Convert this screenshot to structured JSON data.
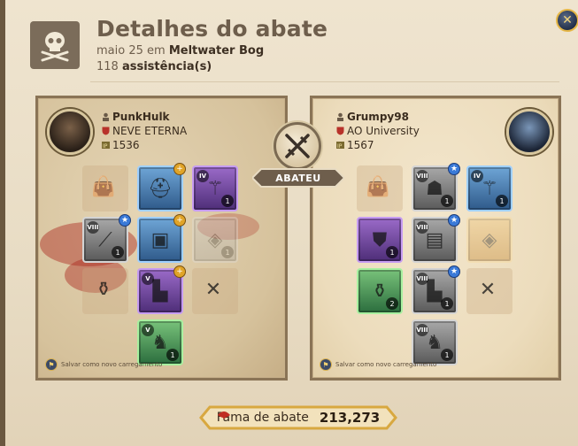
{
  "header": {
    "title": "Detalhes do abate",
    "date": "maio 25 em",
    "location": "Meltwater Bog",
    "assist_count": "118",
    "assist_label": "assistência(s)"
  },
  "killer": {
    "name": "PunkHulk",
    "guild": "NEVE ETERNA",
    "ip": "1536",
    "save_label": "Salvar como novo carregamento",
    "slots": [
      {
        "kind": "empty",
        "icon": "bag-icon"
      },
      {
        "kind": "item",
        "icon": "helmet-icon",
        "tier": "",
        "qty": "",
        "enchant": "+"
      },
      {
        "kind": "item",
        "icon": "staff-icon",
        "tier": "IV",
        "qty": "1",
        "enchant": ""
      },
      {
        "kind": "item",
        "icon": "spear-icon",
        "tier": "VIII",
        "qty": "1",
        "enchant": "★"
      },
      {
        "kind": "item",
        "icon": "armor-icon",
        "tier": "",
        "qty": "",
        "enchant": "+"
      },
      {
        "kind": "item",
        "icon": "offhand-icon",
        "tier": "",
        "qty": "1",
        "enchant": ""
      },
      {
        "kind": "empty",
        "icon": "potion-icon"
      },
      {
        "kind": "item",
        "icon": "boots-icon",
        "tier": "V",
        "qty": "",
        "enchant": "+"
      },
      {
        "kind": "empty",
        "icon": "food-icon"
      },
      {
        "kind": "item",
        "icon": "mount-icon",
        "tier": "V",
        "qty": "1",
        "enchant": ""
      }
    ]
  },
  "victim": {
    "name": "Grumpy98",
    "guild": "AO University",
    "ip": "1567",
    "save_label": "Salvar como novo carregamento",
    "slots": [
      {
        "kind": "empty",
        "icon": "bag-icon"
      },
      {
        "kind": "item",
        "icon": "hood-icon",
        "tier": "VIII",
        "qty": "1",
        "enchant": "★"
      },
      {
        "kind": "item",
        "icon": "staff-icon",
        "tier": "IV",
        "qty": "1",
        "enchant": ""
      },
      {
        "kind": "item",
        "icon": "shield-icon",
        "tier": "",
        "qty": "1",
        "enchant": ""
      },
      {
        "kind": "item",
        "icon": "robe-icon",
        "tier": "VIII",
        "qty": "",
        "enchant": "★"
      },
      {
        "kind": "item",
        "icon": "offhand-icon",
        "tier": "",
        "qty": "",
        "enchant": ""
      },
      {
        "kind": "item",
        "icon": "potion-icon",
        "tier": "",
        "qty": "2",
        "enchant": ""
      },
      {
        "kind": "item",
        "icon": "boots-icon",
        "tier": "VIII",
        "qty": "1",
        "enchant": "★"
      },
      {
        "kind": "empty",
        "icon": "food-icon"
      },
      {
        "kind": "item",
        "icon": "mount-icon",
        "tier": "VIII",
        "qty": "1",
        "enchant": ""
      }
    ]
  },
  "kill_banner": "ABATEU",
  "fame": {
    "label": "Fama de abate",
    "value": "213,273"
  },
  "close_icon": "close-icon",
  "colors": {
    "panel_border": "#8a7456",
    "banner": "#6e5e4c",
    "fame_gold": "#e5b646"
  }
}
